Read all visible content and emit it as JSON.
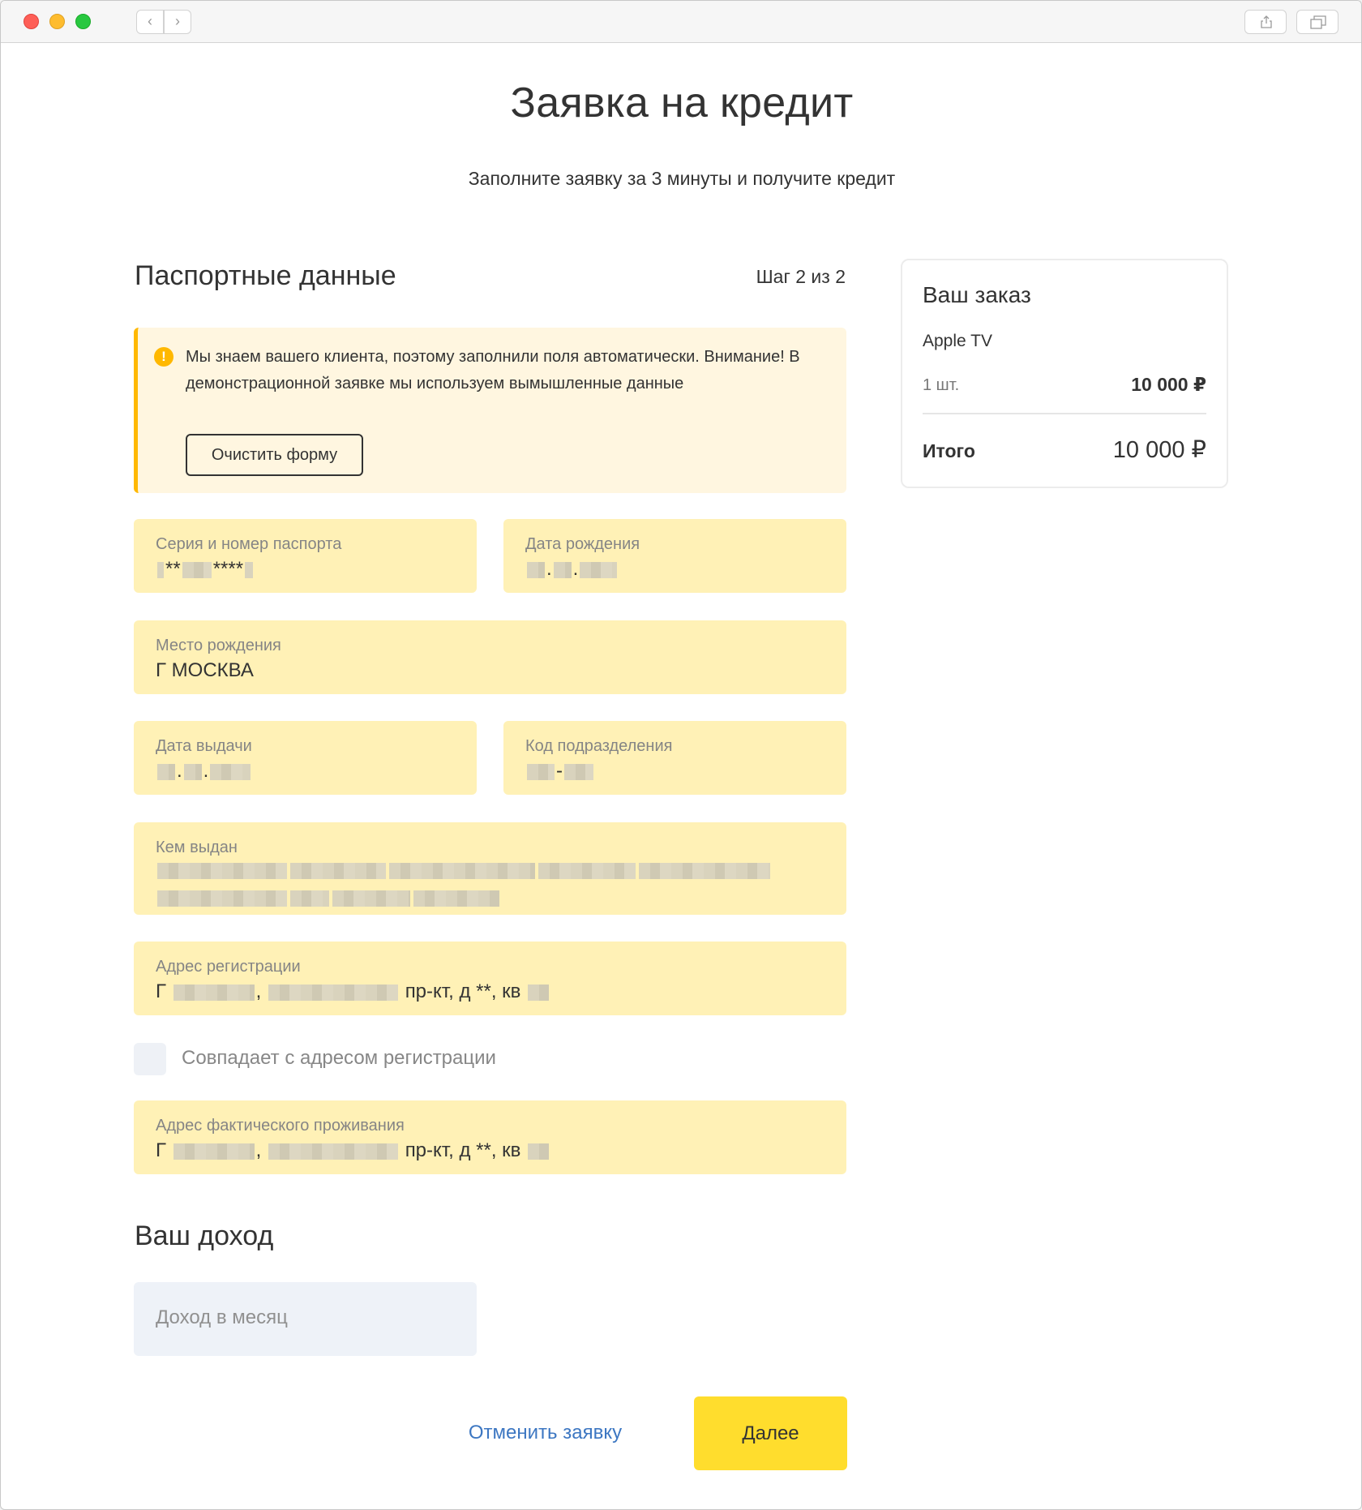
{
  "browser": {
    "back": "‹",
    "forward": "›"
  },
  "header": {
    "title": "Заявка на кредит",
    "subtitle": "Заполните заявку за 3 минуты и получите кредит"
  },
  "passport": {
    "title": "Паспортные данные",
    "step": "Шаг 2 из 2",
    "notice_icon": "!",
    "notice": "Мы знаем вашего клиента, поэтому заполнили поля автоматически. Внимание! В демонстрационной заявке мы используем вымышленные данные",
    "clear_label": "Очистить форму",
    "fields": {
      "series": {
        "label": "Серия и номер паспорта",
        "stars_a": "**",
        "stars_b": "****"
      },
      "birth_date": {
        "label": "Дата рождения",
        "dot": "."
      },
      "birth_place": {
        "label": "Место рождения",
        "value": "Г МОСКВА"
      },
      "issue_date": {
        "label": "Дата выдачи",
        "dot": "."
      },
      "dept_code": {
        "label": "Код подразделения",
        "dash": "-"
      },
      "issued_by": {
        "label": "Кем выдан"
      },
      "reg_address": {
        "label": "Адрес регистрации",
        "prefix": "Г",
        "comma": ",",
        "suffix": "пр-кт, д **, кв"
      },
      "same_address": {
        "label": "Совпадает с адресом регистрации"
      },
      "actual_address": {
        "label": "Адрес фактического проживания",
        "prefix": "Г",
        "comma": ",",
        "suffix": "пр-кт, д **, кв"
      }
    }
  },
  "income": {
    "title": "Ваш доход",
    "placeholder": "Доход в месяц"
  },
  "actions": {
    "cancel": "Отменить заявку",
    "next": "Далее"
  },
  "order": {
    "title": "Ваш заказ",
    "product": "Apple TV",
    "qty": "1 шт.",
    "price": "10 000 ₽",
    "total_label": "Итого",
    "total_value": "10 000 ₽"
  },
  "colors": {
    "accent": "#ffdd2d",
    "field_bg": "#fff1b6",
    "notice_bar": "#ffb800",
    "link": "#3d77c2"
  }
}
